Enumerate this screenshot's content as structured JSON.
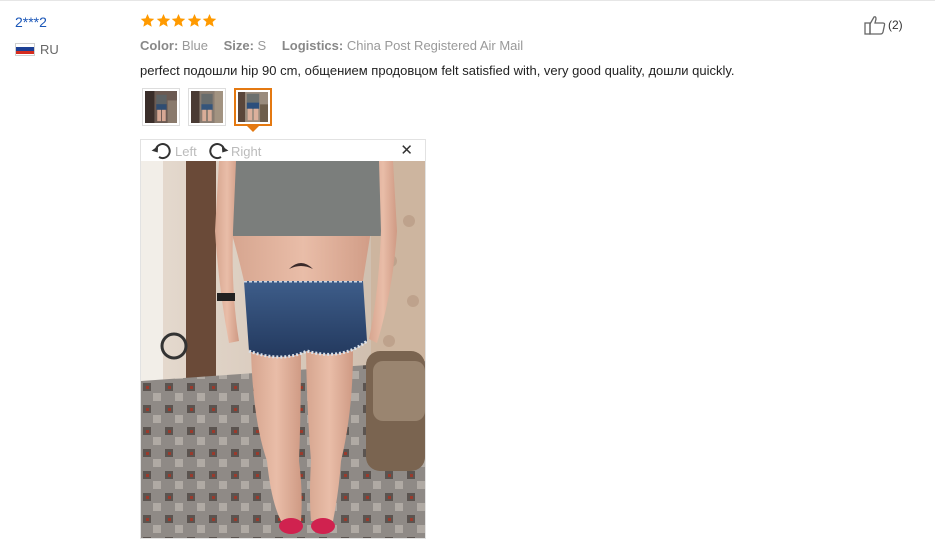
{
  "review": {
    "user": {
      "name": "2***2",
      "country": "RU",
      "flag_colors": [
        "#ffffff",
        "#1c3f94",
        "#d52b1e"
      ]
    },
    "rating": 5,
    "star_color": "#ff9a00",
    "meta": {
      "color_label": "Color:",
      "color_value": "Blue",
      "size_label": "Size:",
      "size_value": "S",
      "logistics_label": "Logistics:",
      "logistics_value": "China Post Registered Air Mail"
    },
    "text": "perfect подошли hip 90 cm, общением продовцом felt satisfied with, very good quality, дошли quickly.",
    "thumbnails": [
      {
        "name": "photo-1",
        "active": false
      },
      {
        "name": "photo-2",
        "active": false
      },
      {
        "name": "photo-3",
        "active": true
      }
    ],
    "viewer": {
      "rotate_left_label": "Left",
      "rotate_right_label": "Right",
      "close_icon": "close-icon"
    },
    "helpful": {
      "icon": "thumbs-up-icon",
      "count_label": "(2)"
    }
  }
}
